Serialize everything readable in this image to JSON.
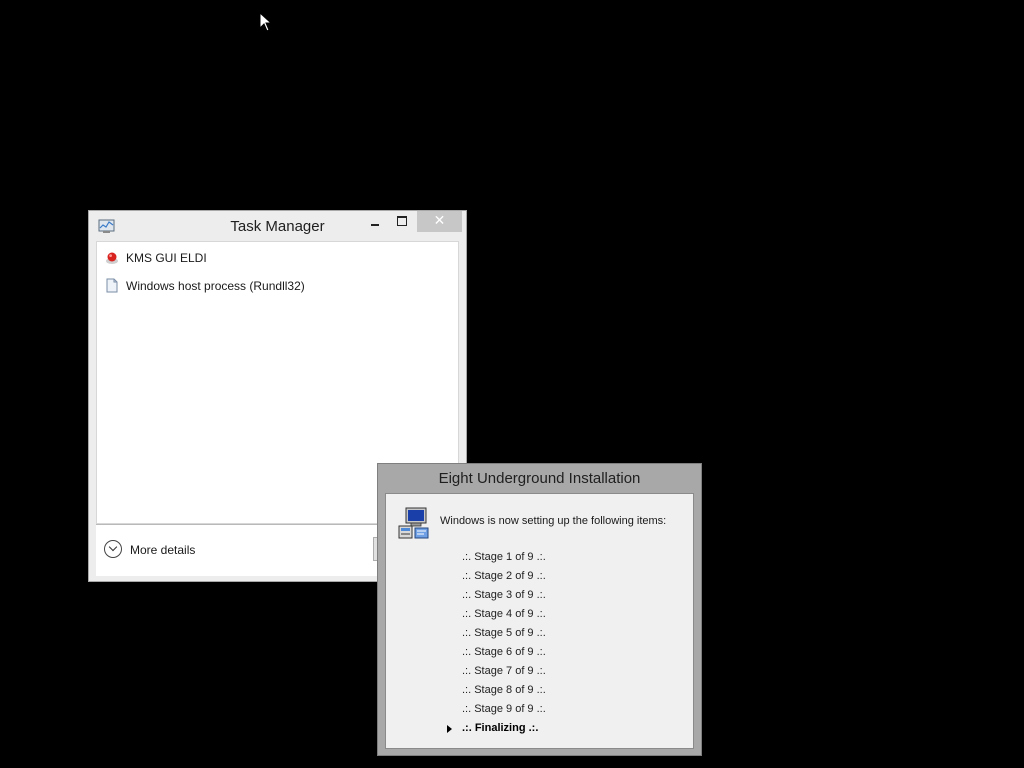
{
  "task_manager": {
    "title": "Task Manager",
    "close_glyph": "✕",
    "processes": [
      {
        "name": "KMS GUI ELDI",
        "icon": "red-dot-app-icon"
      },
      {
        "name": "Windows host process (Rundll32)",
        "icon": "document-icon"
      }
    ],
    "more_details": "More details"
  },
  "installer": {
    "title": "Eight Underground Installation",
    "message": "Windows is now setting up the following items:",
    "stages": [
      ".:. Stage 1 of 9 .:.",
      ".:. Stage 2 of 9 .:.",
      ".:. Stage 3 of 9 .:.",
      ".:. Stage 4 of 9 .:.",
      ".:. Stage 5 of 9 .:.",
      ".:. Stage 6 of 9 .:.",
      ".:. Stage 7 of 9 .:.",
      ".:. Stage 8 of 9 .:.",
      ".:. Stage 9 of 9 .:."
    ],
    "final_stage": ".:. Finalizing .:."
  }
}
